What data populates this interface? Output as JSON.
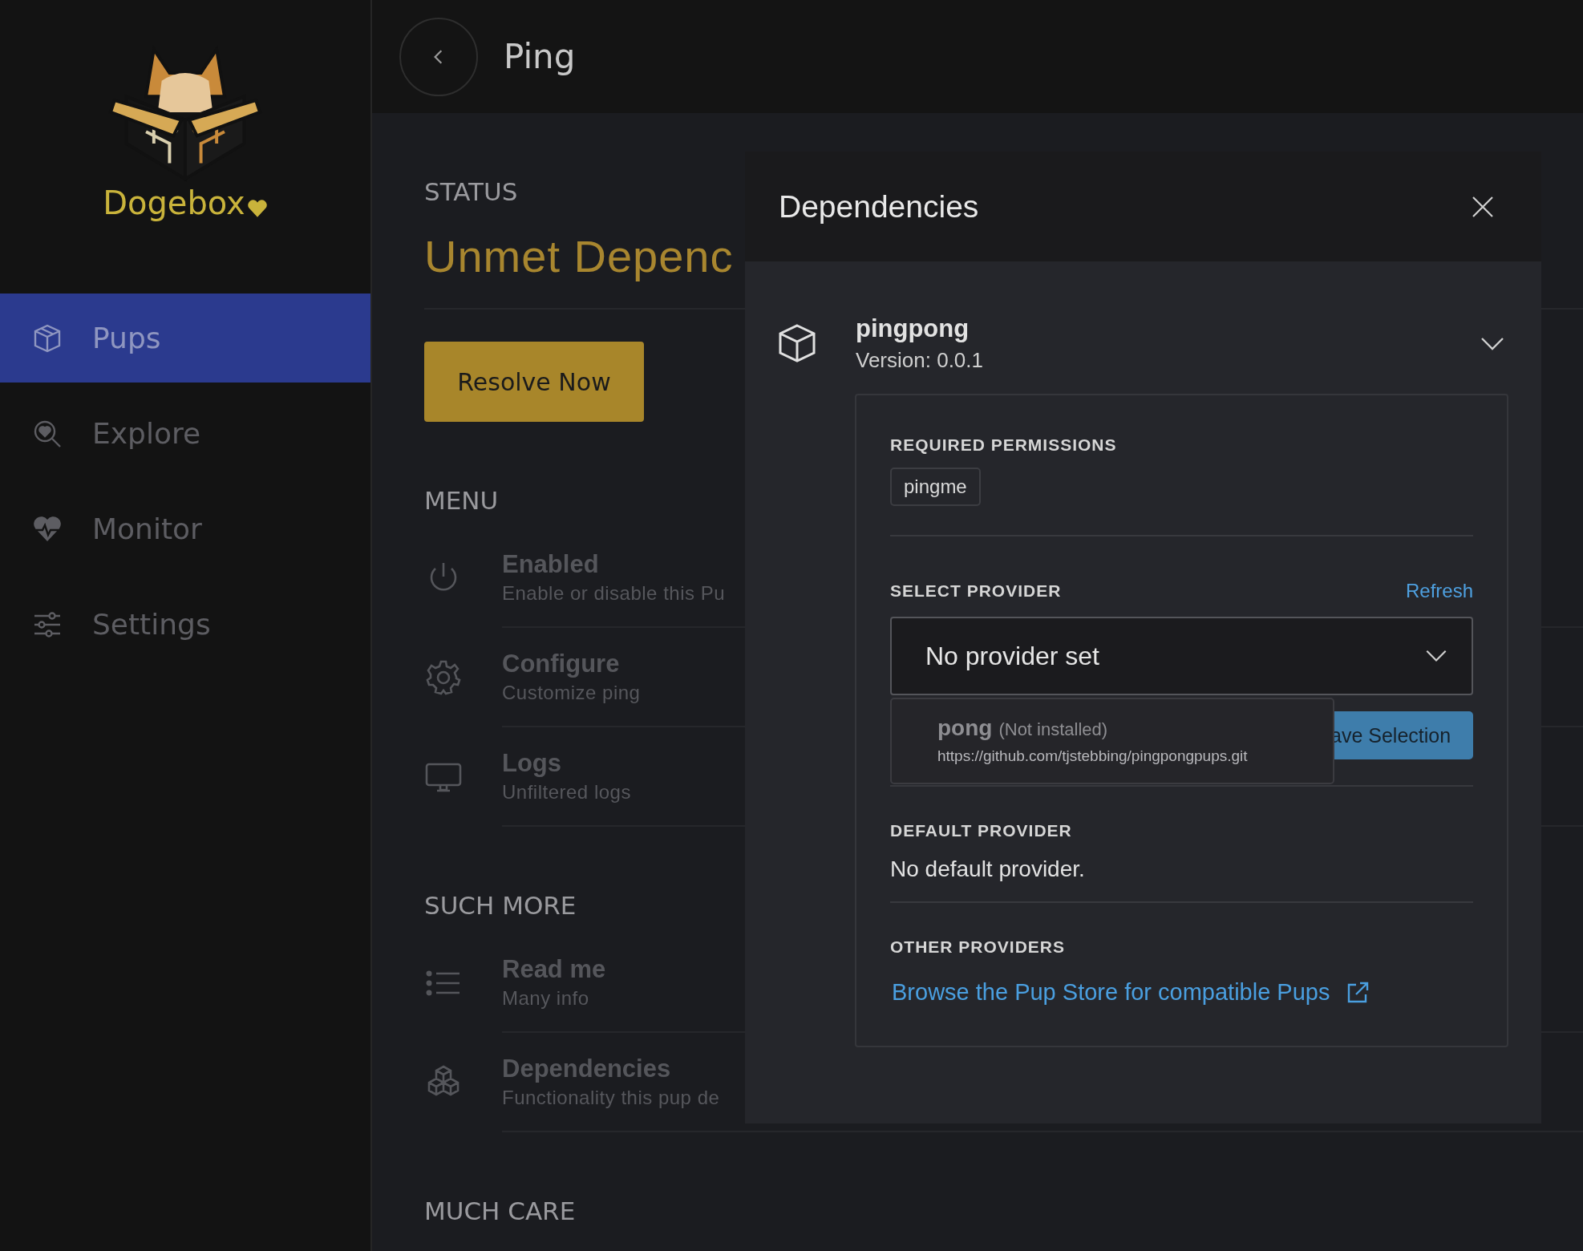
{
  "sidebar": {
    "brand": "Dogebox",
    "items": [
      {
        "label": "Pups",
        "selected": true
      },
      {
        "label": "Explore",
        "selected": false
      },
      {
        "label": "Monitor",
        "selected": false
      },
      {
        "label": "Settings",
        "selected": false
      }
    ]
  },
  "header": {
    "title": "Ping"
  },
  "status": {
    "heading": "STATUS",
    "value": "Unmet Depenc",
    "action": "Resolve Now"
  },
  "sections": [
    {
      "heading": "MENU",
      "items": [
        {
          "title": "Enabled",
          "subtitle": "Enable or disable this Pu"
        },
        {
          "title": "Configure",
          "subtitle": "Customize ping"
        },
        {
          "title": "Logs",
          "subtitle": "Unfiltered logs"
        }
      ]
    },
    {
      "heading": "SUCH MORE",
      "items": [
        {
          "title": "Read me",
          "subtitle": "Many info"
        },
        {
          "title": "Dependencies",
          "subtitle": "Functionality this pup de"
        }
      ]
    },
    {
      "heading": "MUCH CARE"
    }
  ],
  "modal": {
    "title": "Dependencies",
    "dependency": {
      "name": "pingpong",
      "version": "Version: 0.0.1",
      "expanded": true
    },
    "required_permissions": {
      "heading": "REQUIRED PERMISSIONS",
      "tags": [
        "pingme"
      ]
    },
    "select_provider": {
      "heading": "SELECT PROVIDER",
      "refresh": "Refresh",
      "value": "No provider set",
      "save": "ave Selection",
      "options": [
        {
          "name": "pong",
          "note": "(Not installed)",
          "url": "https://github.com/tjstebbing/pingpongpups.git"
        }
      ]
    },
    "default_provider": {
      "heading": "DEFAULT PROVIDER",
      "text": "No default provider."
    },
    "other_providers": {
      "heading": "OTHER PROVIDERS",
      "link": "Browse the Pup Store for compatible Pups"
    }
  }
}
